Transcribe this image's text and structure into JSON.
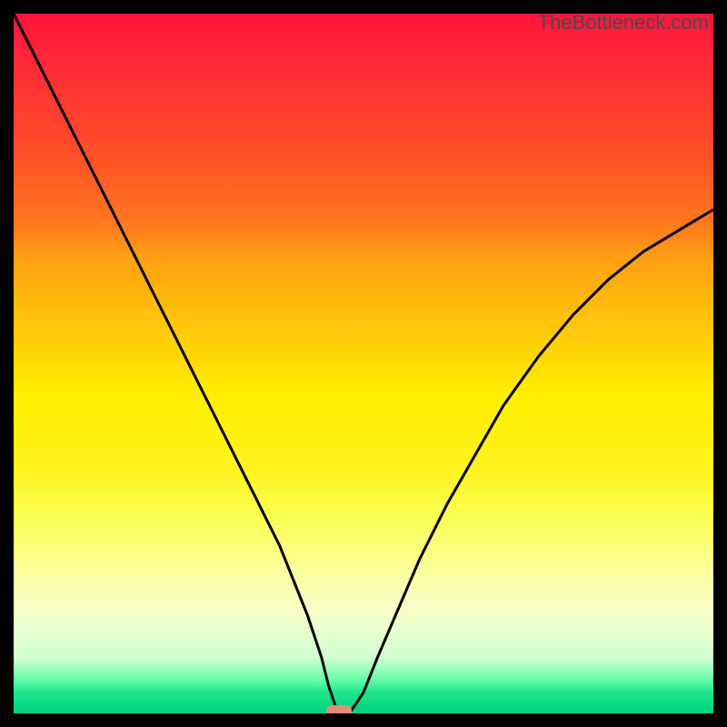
{
  "chart_data": {
    "type": "line",
    "title": "",
    "xlabel": "",
    "ylabel": "",
    "xlim": [
      0,
      100
    ],
    "ylim": [
      0,
      100
    ],
    "x": [
      0,
      2,
      4,
      6,
      8,
      10,
      12,
      14,
      16,
      18,
      20,
      22,
      24,
      26,
      28,
      30,
      32,
      34,
      36,
      38,
      40,
      42,
      44,
      45,
      46,
      47,
      48,
      50,
      52,
      55,
      58,
      62,
      66,
      70,
      75,
      80,
      85,
      90,
      95,
      100
    ],
    "values": [
      100,
      96,
      92,
      88,
      84,
      80,
      76,
      72,
      68,
      64,
      60,
      56,
      52,
      48,
      44,
      40,
      36,
      32,
      28,
      24,
      19,
      14,
      8,
      4,
      1,
      0,
      0,
      3,
      8,
      15,
      22,
      30,
      37,
      44,
      51,
      57,
      62,
      66,
      69,
      72
    ],
    "min_marker": {
      "x": 46.5,
      "y": 0,
      "color": "#e58b7a"
    },
    "attribution": "TheBottleneck.com"
  },
  "colors": {
    "curve": "#000000",
    "marker": "#e58b7a",
    "background_frame": "#000000"
  }
}
